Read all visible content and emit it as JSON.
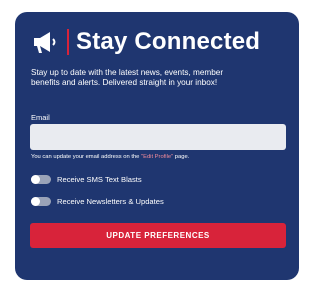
{
  "card": {
    "title": "Stay Connected",
    "icon": "megaphone-icon",
    "description": "Stay up to date with the latest news, events, member benefits and alerts. Delivered straight in your inbox!",
    "colors": {
      "background": "#1f3670",
      "accent": "#d8233a",
      "link": "#f08a9a"
    }
  },
  "email": {
    "label": "Email",
    "value": "",
    "placeholder": ""
  },
  "note": {
    "prefix": "You can update your email address on the ",
    "link": "\"Edit Profile\"",
    "suffix": " page."
  },
  "toggles": {
    "sms": {
      "label": "Receive SMS Text Blasts",
      "on": false
    },
    "newsletters": {
      "label": "Receive Newsletters & Updates",
      "on": false
    }
  },
  "button": {
    "label": "UPDATE PREFERENCES"
  }
}
